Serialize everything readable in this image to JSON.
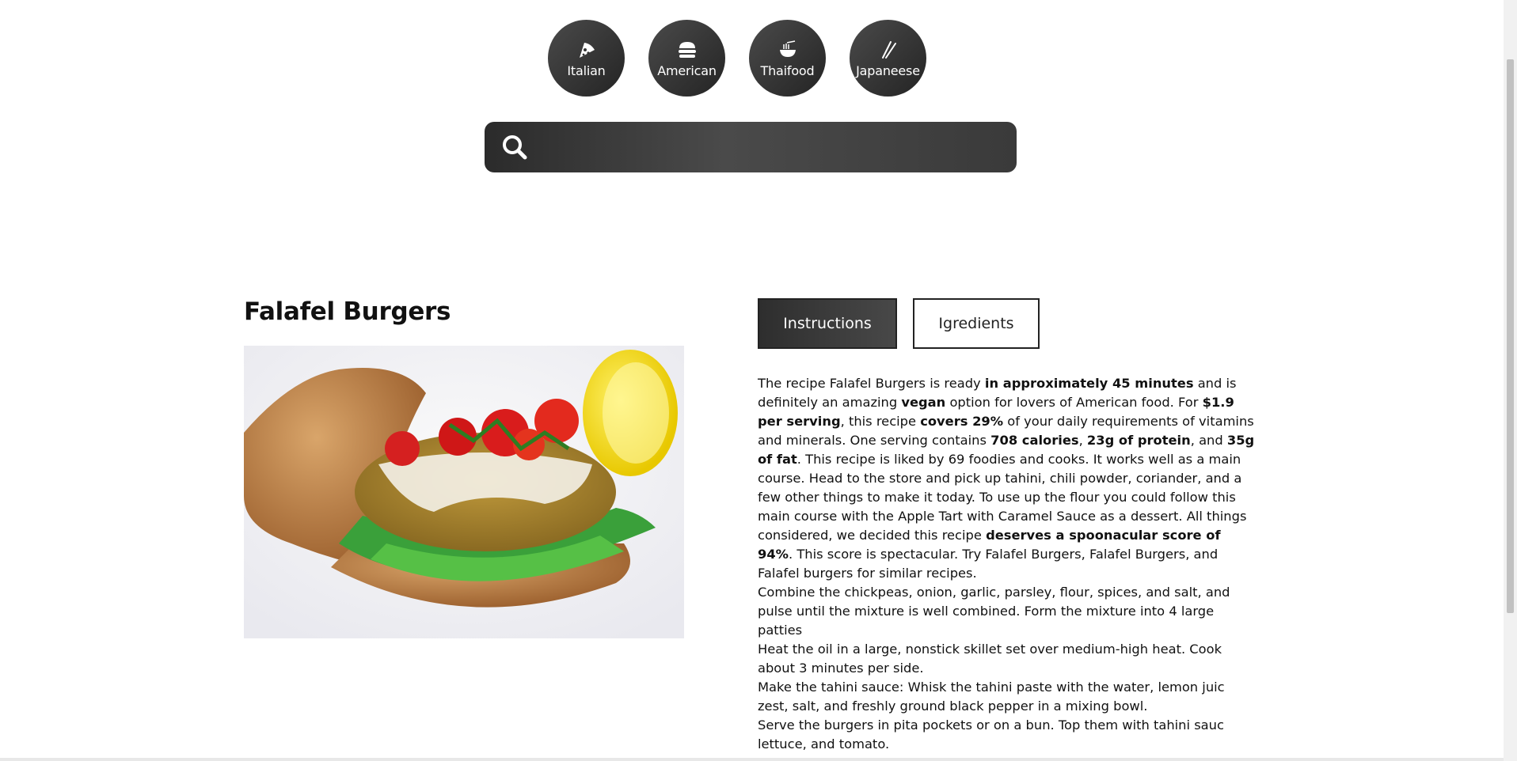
{
  "cuisines": [
    {
      "label": "Italian",
      "icon": "pizza-icon"
    },
    {
      "label": "American",
      "icon": "burger-icon"
    },
    {
      "label": "Thaifood",
      "icon": "noodle-bowl-icon"
    },
    {
      "label": "Japaneese",
      "icon": "chopsticks-icon"
    }
  ],
  "search": {
    "placeholder": "",
    "value": "",
    "icon": "search-icon"
  },
  "recipe": {
    "title": "Falafel Burgers",
    "image_alt": "Falafel Burgers",
    "tabs": [
      {
        "label": "Instructions",
        "active": true
      },
      {
        "label": "Igredients",
        "active": false
      }
    ],
    "summary": [
      {
        "t": "The recipe Falafel Burgers is ready ",
        "b": false
      },
      {
        "t": "in approximately 45 minutes",
        "b": true
      },
      {
        "t": " and is definitely an amazing ",
        "b": false
      },
      {
        "t": "vegan",
        "b": true
      },
      {
        "t": " option for lovers of American food. For ",
        "b": false
      },
      {
        "t": "$1.9 per serving",
        "b": true
      },
      {
        "t": ", this recipe ",
        "b": false
      },
      {
        "t": "covers 29%",
        "b": true
      },
      {
        "t": " of your daily requirements of vitamins and minerals. One serving contains ",
        "b": false
      },
      {
        "t": "708 calories",
        "b": true
      },
      {
        "t": ", ",
        "b": false
      },
      {
        "t": "23g of protein",
        "b": true
      },
      {
        "t": ", and ",
        "b": false
      },
      {
        "t": "35g of fat",
        "b": true
      },
      {
        "t": ". This recipe is liked by 69 foodies and cooks. It works well as a main course. Head to the store and pick up tahini, chili powder, coriander, and a few other things to make it today. To use up the flour you could follow this main course with the Apple Tart with Caramel Sauce as a dessert. All things considered, we decided this recipe ",
        "b": false
      },
      {
        "t": "deserves a spoonacular score of 94%",
        "b": true
      },
      {
        "t": ". This score is spectacular. Try Falafel Burgers, Falafel Burgers, and Falafel burgers for similar recipes.",
        "b": false
      }
    ],
    "steps": [
      "Combine the chickpeas, onion, garlic, parsley, flour, spices, and salt, and pulse until the mixture is well combined. Form the mixture into 4 large patties",
      "Heat the oil in a large, nonstick skillet set over medium-high heat. Cook about 3 minutes per side.",
      "Make the tahini sauce: Whisk the tahini paste with the water, lemon juic zest, salt, and freshly ground black pepper in a mixing bowl.",
      "Serve the burgers in pita pockets or on a bun. Top them with tahini sauc lettuce, and tomato."
    ]
  }
}
